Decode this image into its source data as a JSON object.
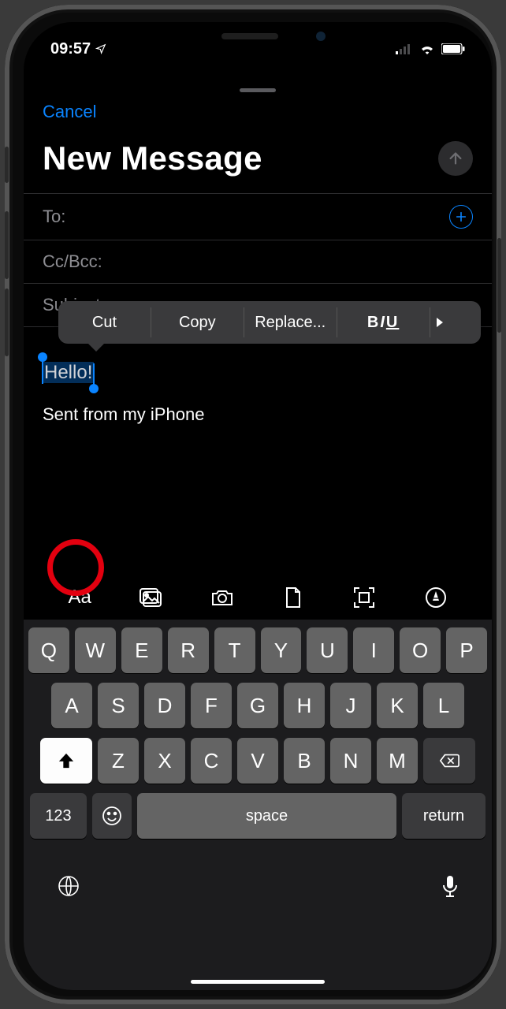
{
  "status": {
    "time": "09:57",
    "location_icon": "location-arrow"
  },
  "sheet": {
    "cancel": "Cancel",
    "title": "New Message",
    "fields": {
      "to": "To:",
      "ccbcc": "Cc/Bcc:",
      "subject": "Subject:"
    },
    "body_selected": "Hello!",
    "signature": "Sent from my iPhone"
  },
  "edit_menu": {
    "cut": "Cut",
    "copy": "Copy",
    "replace": "Replace...",
    "biu_b": "B",
    "biu_i": "I",
    "biu_u": "U",
    "more": "▶"
  },
  "accessory": {
    "format": "Aa",
    "photos": "photos-icon",
    "camera": "camera-icon",
    "file": "file-icon",
    "scan": "scan-icon",
    "markup": "markup-icon"
  },
  "keyboard": {
    "row1": [
      "Q",
      "W",
      "E",
      "R",
      "T",
      "Y",
      "U",
      "I",
      "O",
      "P"
    ],
    "row2": [
      "A",
      "S",
      "D",
      "F",
      "G",
      "H",
      "J",
      "K",
      "L"
    ],
    "row3": [
      "Z",
      "X",
      "C",
      "V",
      "B",
      "N",
      "M"
    ],
    "k123": "123",
    "space": "space",
    "return": "return"
  }
}
